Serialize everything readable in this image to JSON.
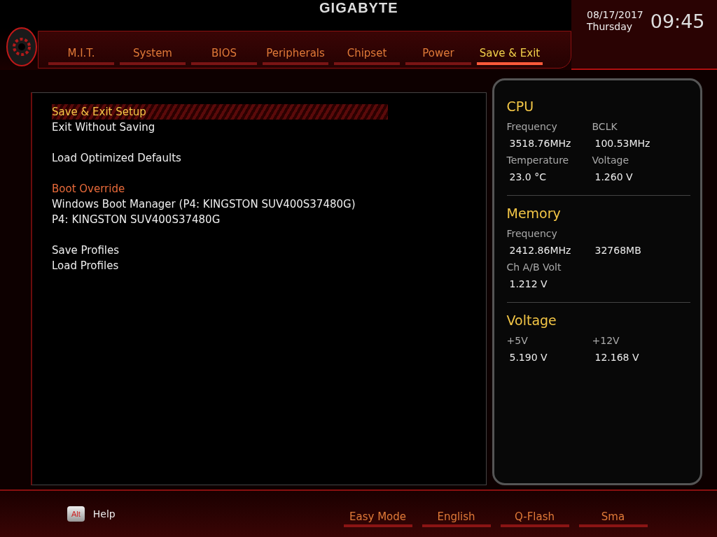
{
  "brand": "GIGABYTE",
  "tabs": [
    {
      "label": "M.I.T.",
      "selected": false
    },
    {
      "label": "System",
      "selected": false
    },
    {
      "label": "BIOS",
      "selected": false
    },
    {
      "label": "Peripherals",
      "selected": false
    },
    {
      "label": "Chipset",
      "selected": false
    },
    {
      "label": "Power",
      "selected": false
    },
    {
      "label": "Save & Exit",
      "selected": true
    }
  ],
  "clock": {
    "date": "08/17/2017",
    "day": "Thursday",
    "time": "09:45"
  },
  "menu": [
    [
      {
        "kind": "item",
        "label": "Save & Exit Setup",
        "selected": true
      },
      {
        "kind": "item",
        "label": "Exit Without Saving",
        "selected": false
      }
    ],
    [
      {
        "kind": "item",
        "label": "Load Optimized Defaults",
        "selected": false
      }
    ],
    [
      {
        "kind": "heading",
        "label": "Boot Override"
      },
      {
        "kind": "item",
        "label": "Windows Boot Manager (P4: KINGSTON SUV400S37480G)",
        "selected": false
      },
      {
        "kind": "item",
        "label": "P4: KINGSTON SUV400S37480G",
        "selected": false
      }
    ],
    [
      {
        "kind": "item",
        "label": "Save Profiles",
        "selected": false
      },
      {
        "kind": "item",
        "label": "Load Profiles",
        "selected": false
      }
    ]
  ],
  "monitor": [
    {
      "title": "CPU",
      "rows": [
        {
          "kind": "label",
          "cells": [
            "Frequency",
            "BCLK"
          ]
        },
        {
          "kind": "value",
          "cells": [
            "3518.76MHz",
            "100.53MHz"
          ]
        },
        {
          "kind": "label",
          "cells": [
            "Temperature",
            "Voltage"
          ]
        },
        {
          "kind": "value",
          "cells": [
            "23.0 °C",
            "1.260 V"
          ]
        }
      ]
    },
    {
      "title": "Memory",
      "rows": [
        {
          "kind": "label",
          "cells": [
            "Frequency"
          ]
        },
        {
          "kind": "value",
          "cells": [
            "2412.86MHz",
            "32768MB"
          ]
        },
        {
          "kind": "label",
          "cells": [
            "Ch A/B Volt"
          ]
        },
        {
          "kind": "value",
          "cells": [
            "1.212 V"
          ]
        }
      ]
    },
    {
      "title": "Voltage",
      "rows": [
        {
          "kind": "label",
          "cells": [
            "+5V",
            "+12V"
          ]
        },
        {
          "kind": "value",
          "cells": [
            "5.190 V",
            "12.168 V"
          ]
        }
      ]
    }
  ],
  "help": {
    "key": "Alt",
    "label": "Help"
  },
  "bottom_buttons": [
    "Easy Mode",
    "English",
    "Q-Flash",
    "Sma"
  ]
}
